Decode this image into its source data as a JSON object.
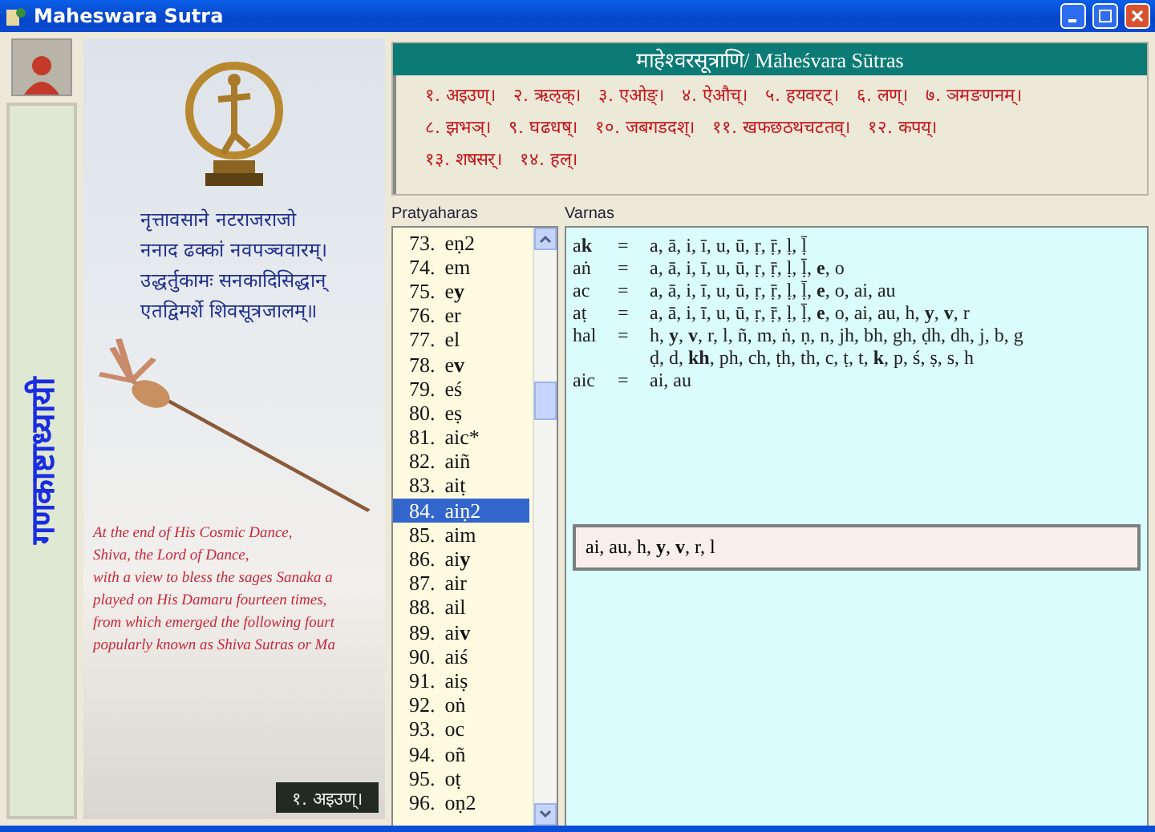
{
  "window": {
    "title": "Maheswara Sutra"
  },
  "side_strip": {
    "vertical_title": "गणकाष्टाध्यायी"
  },
  "poster": {
    "verse": [
      "नृत्तावसाने नटराजराजो",
      "ननाद ढक्कां नवपञ्चवारम्।",
      "उद्धर्तुकामः सनकादिसिद्धान्",
      "एतद्विमर्शे शिवसूत्रजालम्॥"
    ],
    "story": [
      "At the end of His Cosmic Dance,",
      "Shiva, the Lord of Dance,",
      "with a view to bless the sages Sanaka a",
      "played on His Damaru fourteen times,",
      "from which emerged the following fourt",
      "popularly known as Shiva Sutras or Ma"
    ],
    "caption": "१. अइउण्।"
  },
  "sutras": {
    "title": "माहेश्वरसूत्राणि/ Māheśvara Sūtras",
    "lines": [
      [
        "१. अइउण्।",
        "२. ऋऌक्।",
        "३. एओङ्।",
        "४. ऐऔच्।",
        "५. हयवरट्।",
        "६. लण्।",
        "७. ञमङणनम्।"
      ],
      [
        "८. झभञ्।",
        "९. घढधष्।",
        "१०. जबगडदश्।",
        "११. खफछठथचटतव्।",
        "१२. कपय्।"
      ],
      [
        "१३. शषसर्।",
        "१४. हल्।"
      ]
    ]
  },
  "pratyaharas": {
    "label": "Pratyaharas",
    "items": [
      {
        "number": "73.",
        "name": "eṇ2",
        "selected": false
      },
      {
        "number": "74.",
        "name": "em",
        "selected": false
      },
      {
        "number": "75.",
        "name": "e**y**",
        "selected": false
      },
      {
        "number": "76.",
        "name": "er",
        "selected": false
      },
      {
        "number": "77.",
        "name": "el",
        "selected": false
      },
      {
        "number": "78.",
        "name": "e**v**",
        "selected": false
      },
      {
        "number": "79.",
        "name": "eś",
        "selected": false
      },
      {
        "number": "80.",
        "name": "eṣ",
        "selected": false
      },
      {
        "number": "81.",
        "name": "aic*",
        "selected": false
      },
      {
        "number": "82.",
        "name": "aiñ",
        "selected": false
      },
      {
        "number": "83.",
        "name": "aiṭ",
        "selected": false
      },
      {
        "number": "84.",
        "name": "aiṇ2",
        "selected": true
      },
      {
        "number": "85.",
        "name": "aim",
        "selected": false
      },
      {
        "number": "86.",
        "name": "ai**y**",
        "selected": false
      },
      {
        "number": "87.",
        "name": "air",
        "selected": false
      },
      {
        "number": "88.",
        "name": "ail",
        "selected": false
      },
      {
        "number": "89.",
        "name": "ai**v**",
        "selected": false
      },
      {
        "number": "90.",
        "name": "aiś",
        "selected": false
      },
      {
        "number": "91.",
        "name": "aiṣ",
        "selected": false
      },
      {
        "number": "92.",
        "name": "oṅ",
        "selected": false
      },
      {
        "number": "93.",
        "name": "oc",
        "selected": false
      },
      {
        "number": "94.",
        "name": "oñ",
        "selected": false
      },
      {
        "number": "95.",
        "name": "oṭ",
        "selected": false
      },
      {
        "number": "96.",
        "name": "oṇ2",
        "selected": false
      }
    ]
  },
  "varnas": {
    "label": "Varnas",
    "rows": [
      {
        "term": "a**k**",
        "sign": "=",
        "lines": [
          "a, ā, i, ī, u, ū, ṛ, ṝ, ḷ, ḹ"
        ]
      },
      {
        "term": "aṅ",
        "sign": "=",
        "lines": [
          "a, ā, i, ī, u, ū, ṛ, ṝ, ḷ, ḹ, **e**, o"
        ]
      },
      {
        "term": "ac",
        "sign": "=",
        "lines": [
          "a, ā, i, ī, u, ū, ṛ, ṝ, ḷ, ḹ, **e**, o, ai, au"
        ]
      },
      {
        "term": "aṭ",
        "sign": "=",
        "lines": [
          "a, ā, i, ī, u, ū, ṛ, ṝ, ḷ, ḹ, **e**, o, ai, au, h, **y**, **v**, r"
        ]
      },
      {
        "term": "hal",
        "sign": "=",
        "lines": [
          "h, **y**, **v**, r, l, ñ, m, ṅ, ṇ, n, jh, bh, gh, ḍh, dh, j, b, g",
          "ḍ, d, **kh**, ph, ch, ṭh, th, c, ṭ, t, **k**, p, ś, ṣ, s, h"
        ]
      },
      {
        "term": "aic",
        "sign": "=",
        "lines": [
          "ai, au"
        ]
      }
    ],
    "result": "ai, au, h, **y**, **v**, r, l"
  }
}
